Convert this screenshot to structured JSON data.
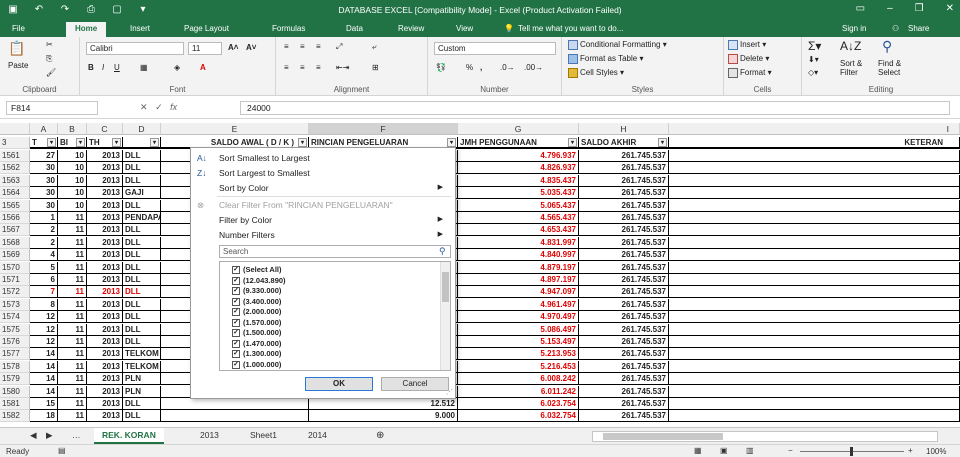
{
  "window": {
    "title": "DATABASE EXCEL  [Compatibility Mode] - Excel (Product Activation Failed)",
    "sign_in": "Sign in",
    "share": "Share"
  },
  "tabs": [
    "File",
    "Home",
    "Insert",
    "Page Layout",
    "Formulas",
    "Data",
    "Review",
    "View"
  ],
  "tell_me": "Tell me what you want to do...",
  "ribbon": {
    "clipboard": {
      "label": "Clipboard",
      "paste": "Paste"
    },
    "font": {
      "label": "Font",
      "name": "Calibri",
      "size": "11"
    },
    "alignment": {
      "label": "Alignment"
    },
    "number": {
      "label": "Number",
      "format": "Custom"
    },
    "styles": {
      "label": "Styles",
      "cond": "Conditional Formatting",
      "table": "Format as Table",
      "cell": "Cell Styles"
    },
    "cells": {
      "label": "Cells",
      "insert": "Insert",
      "delete": "Delete",
      "format": "Format"
    },
    "editing": {
      "label": "Editing",
      "sort": "Sort & Filter",
      "find": "Find & Select"
    }
  },
  "formula": {
    "name_box": "F814",
    "value": "24000",
    "fx": "fx"
  },
  "columns": [
    "A",
    "B",
    "C",
    "D",
    "E",
    "F",
    "G",
    "H",
    "I"
  ],
  "header_row": {
    "row": "3",
    "a": "T",
    "b": "BI",
    "c": "TH",
    "e": "SALDO AWAL ( D / K )",
    "f": "RINCIAN PENGELUARAN",
    "g": "JMH PENGGUNAAN",
    "h": "SALDO AKHIR",
    "i": "KETERAN"
  },
  "rows": [
    {
      "n": "1561",
      "a": "27",
      "b": "10",
      "c": "2013",
      "d": "DLL",
      "f": "",
      "g": "4.796.937",
      "h": "261.745.537"
    },
    {
      "n": "1562",
      "a": "30",
      "b": "10",
      "c": "2013",
      "d": "DLL",
      "f": "",
      "g": "4.826.937",
      "h": "261.745.537"
    },
    {
      "n": "1563",
      "a": "30",
      "b": "10",
      "c": "2013",
      "d": "DLL",
      "f": "",
      "g": "4.835.437",
      "h": "261.745.537"
    },
    {
      "n": "1564",
      "a": "30",
      "b": "10",
      "c": "2013",
      "d": "GAJI",
      "f": "",
      "g": "5.035.437",
      "h": "261.745.537"
    },
    {
      "n": "1565",
      "a": "30",
      "b": "10",
      "c": "2013",
      "d": "DLL",
      "f": "",
      "g": "5.065.437",
      "h": "261.745.537"
    },
    {
      "n": "1566",
      "a": "1",
      "b": "11",
      "c": "2013",
      "d": "PENDAPAT",
      "f": "",
      "g": "4.565.437",
      "h": "261.745.537"
    },
    {
      "n": "1567",
      "a": "2",
      "b": "11",
      "c": "2013",
      "d": "DLL",
      "f": "",
      "g": "4.653.437",
      "h": "261.745.537"
    },
    {
      "n": "1568",
      "a": "2",
      "b": "11",
      "c": "2013",
      "d": "DLL",
      "f": "",
      "g": "4.831.997",
      "h": "261.745.537"
    },
    {
      "n": "1569",
      "a": "4",
      "b": "11",
      "c": "2013",
      "d": "DLL",
      "f": "",
      "g": "4.840.997",
      "h": "261.745.537"
    },
    {
      "n": "1570",
      "a": "5",
      "b": "11",
      "c": "2013",
      "d": "DLL",
      "f": "",
      "g": "4.879.197",
      "h": "261.745.537"
    },
    {
      "n": "1571",
      "a": "6",
      "b": "11",
      "c": "2013",
      "d": "DLL",
      "f": "",
      "g": "4.897.197",
      "h": "261.745.537"
    },
    {
      "n": "1572",
      "a": "7",
      "b": "11",
      "c": "2013",
      "d": "DLL",
      "f": "",
      "g": "4.947.097",
      "h": "261.745.537"
    },
    {
      "n": "1573",
      "a": "8",
      "b": "11",
      "c": "2013",
      "d": "DLL",
      "f": "",
      "g": "4.961.497",
      "h": "261.745.537"
    },
    {
      "n": "1574",
      "a": "12",
      "b": "11",
      "c": "2013",
      "d": "DLL",
      "f": "",
      "g": "4.970.497",
      "h": "261.745.537"
    },
    {
      "n": "1575",
      "a": "12",
      "b": "11",
      "c": "2013",
      "d": "DLL",
      "f": "",
      "g": "5.086.497",
      "h": "261.745.537"
    },
    {
      "n": "1576",
      "a": "12",
      "b": "11",
      "c": "2013",
      "d": "DLL",
      "f": "",
      "g": "5.153.497",
      "h": "261.745.537"
    },
    {
      "n": "1577",
      "a": "14",
      "b": "11",
      "c": "2013",
      "d": "TELKOM",
      "f": "",
      "g": "5.213.953",
      "h": "261.745.537"
    },
    {
      "n": "1578",
      "a": "14",
      "b": "11",
      "c": "2013",
      "d": "TELKOM",
      "f": "",
      "g": "5.216.453",
      "h": "261.745.537"
    },
    {
      "n": "1579",
      "a": "14",
      "b": "11",
      "c": "2013",
      "d": "PLN",
      "f": "",
      "g": "6.008.242",
      "h": "261.745.537"
    },
    {
      "n": "1580",
      "a": "14",
      "b": "11",
      "c": "2013",
      "d": "PLN",
      "f": "",
      "g": "6.011.242",
      "h": "261.745.537"
    },
    {
      "n": "1581",
      "a": "15",
      "b": "11",
      "c": "2013",
      "d": "DLL",
      "f": "12.512",
      "g": "6.023.754",
      "h": "261.745.537"
    },
    {
      "n": "1582",
      "a": "18",
      "b": "11",
      "c": "2013",
      "d": "DLL",
      "f": "9.000",
      "g": "6.032.754",
      "h": "261.745.537"
    }
  ],
  "filter_menu": {
    "sort_asc": "Sort Smallest to Largest",
    "sort_desc": "Sort Largest to Smallest",
    "sort_color": "Sort by Color",
    "clear": "Clear Filter From \"RINCIAN PENGELUARAN\"",
    "filter_color": "Filter by Color",
    "number_filters": "Number Filters",
    "search_placeholder": "Search",
    "items": [
      "(Select All)",
      "(12.043.890)",
      "(9.330.000)",
      "(3.400.000)",
      "(2.000.000)",
      "(1.570.000)",
      "(1.500.000)",
      "(1.470.000)",
      "(1.300.000)",
      "(1.000.000)"
    ],
    "ok": "OK",
    "cancel": "Cancel"
  },
  "sheets": [
    "REK. KORAN",
    "2013",
    "Sheet1",
    "2014"
  ],
  "status": {
    "ready": "Ready",
    "zoom": "100%"
  }
}
